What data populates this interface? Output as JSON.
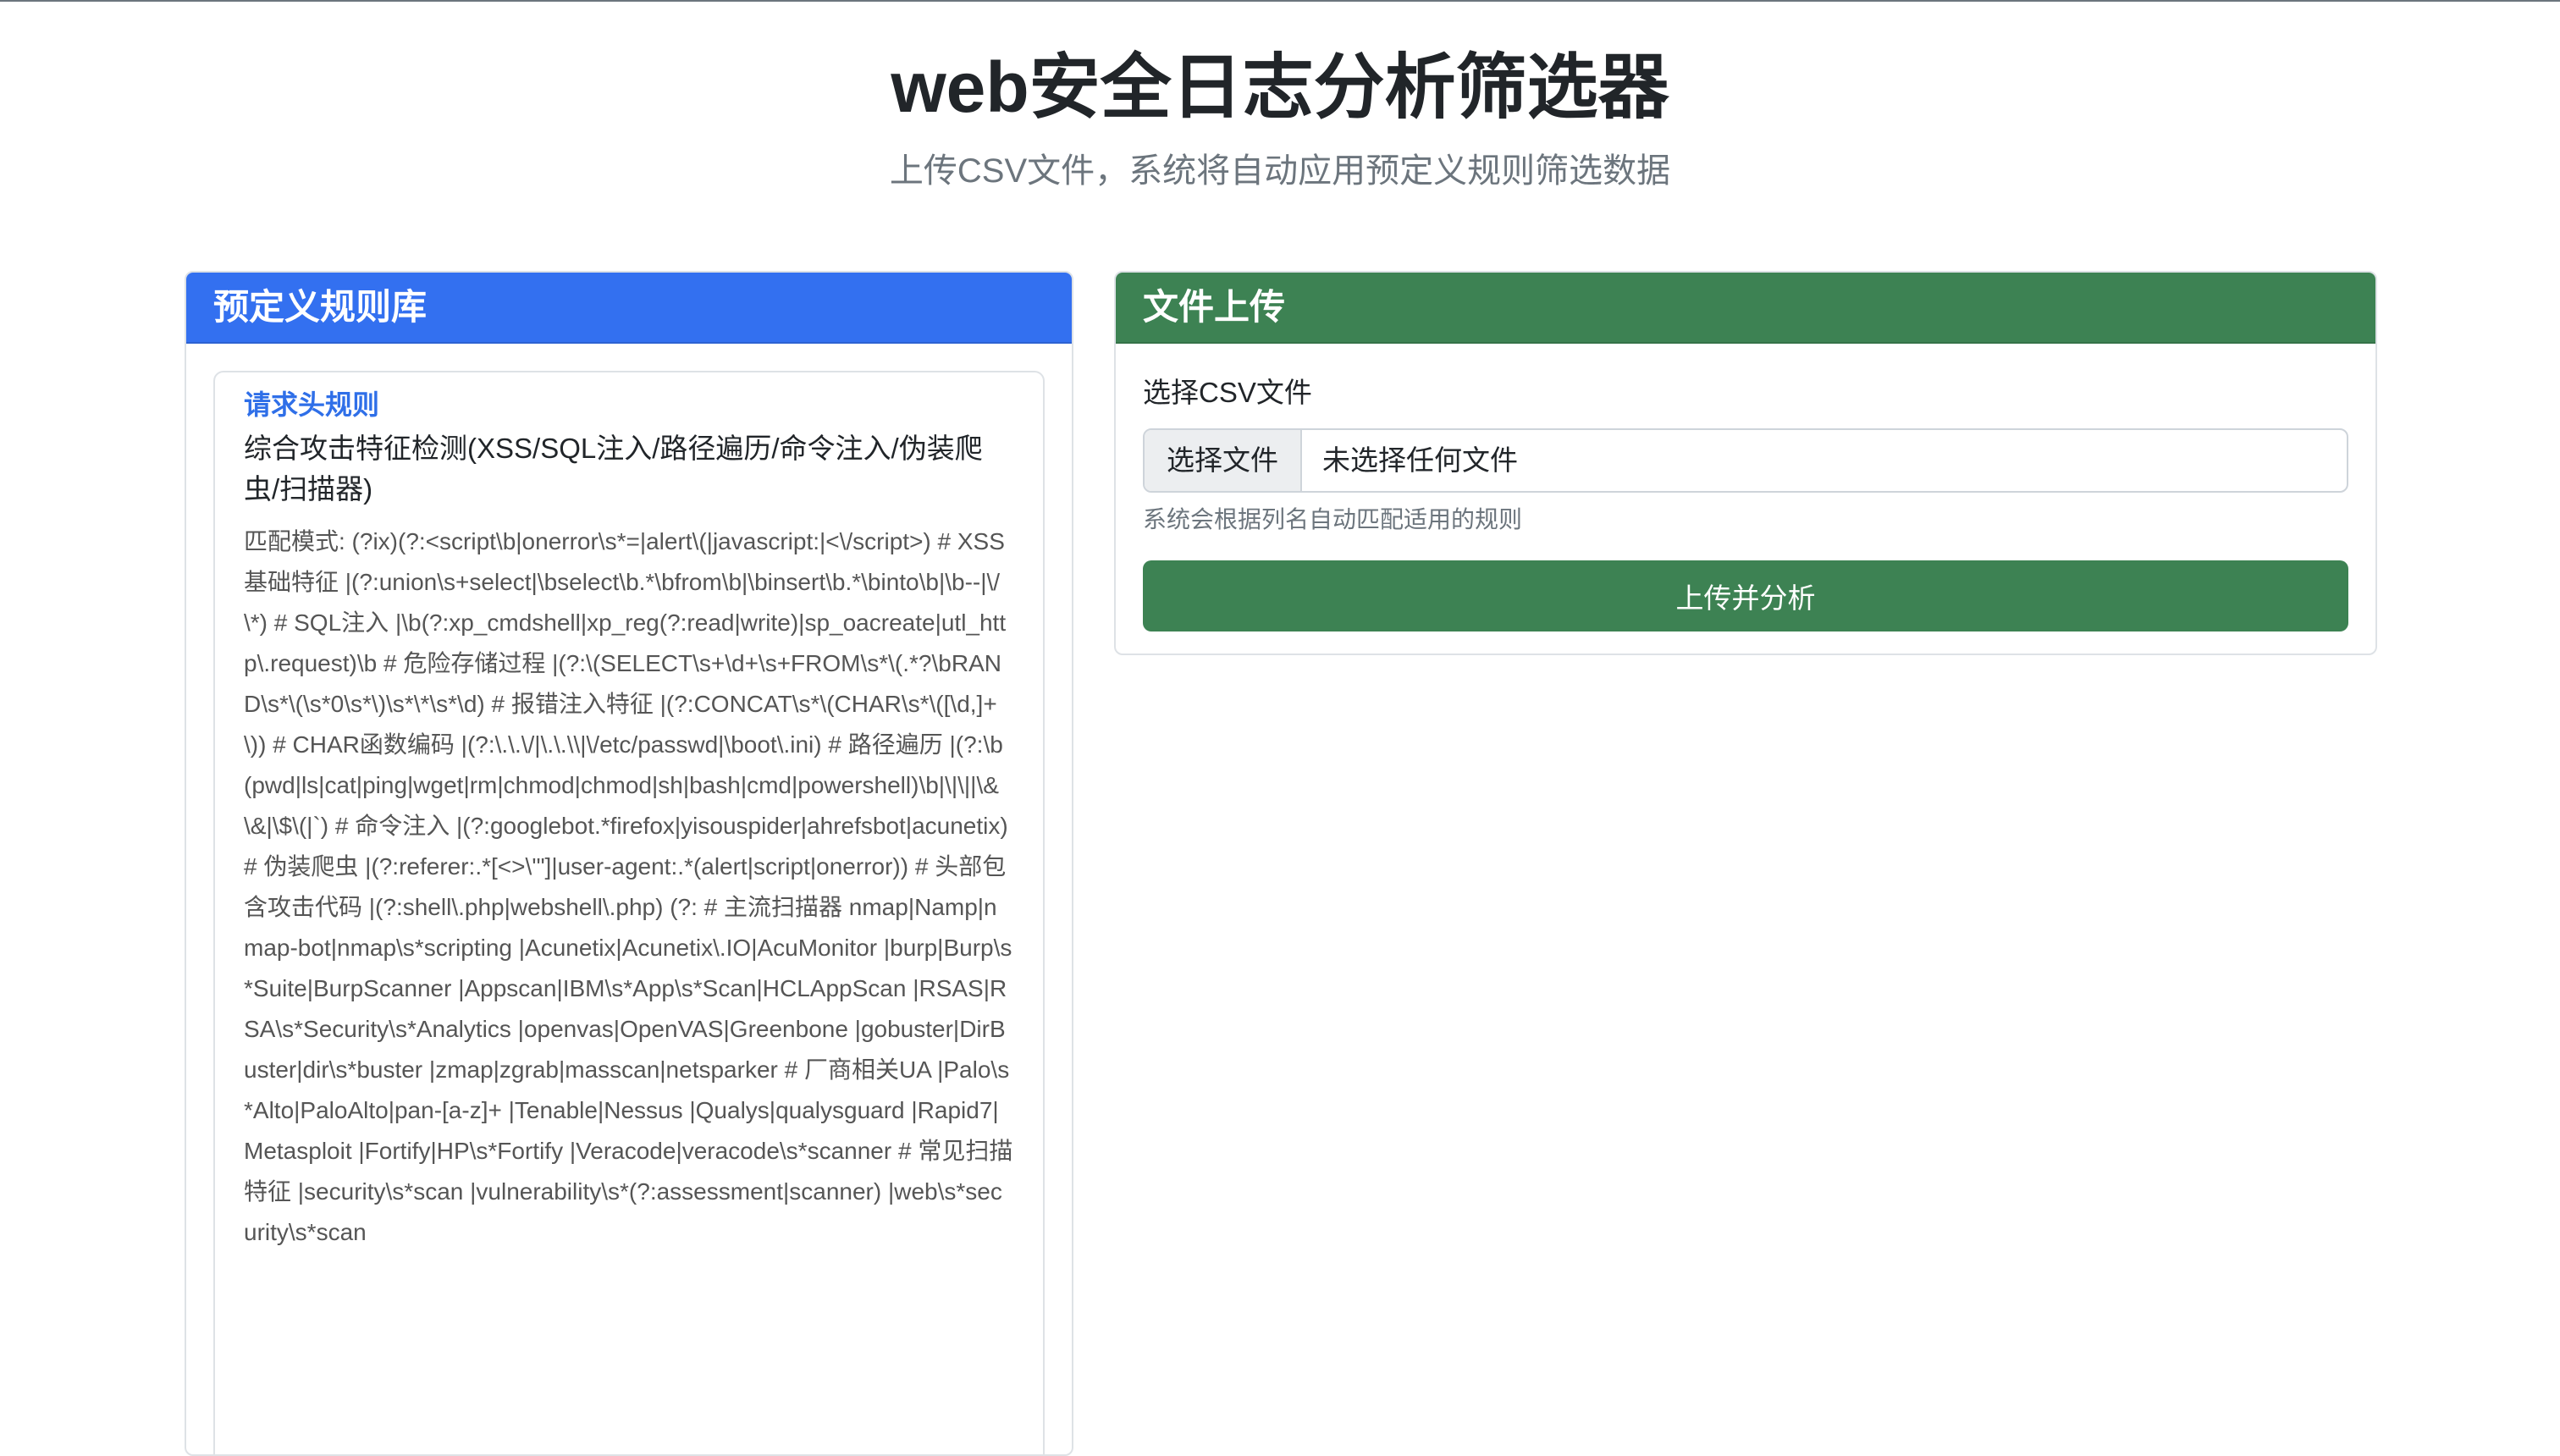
{
  "page": {
    "title": "web安全日志分析筛选器",
    "subtitle": "上传CSV文件，系统将自动应用预定义规则筛选数据"
  },
  "rules_panel": {
    "header": "预定义规则库",
    "rules": [
      {
        "category": "请求头规则",
        "name": "综合攻击特征检测(XSS/SQL注入/路径遍历/命令注入/伪装爬虫/扫描器)",
        "pattern": "匹配模式: (?ix)(?:<script\\b|onerror\\s*=|alert\\(|javascript:|<\\/script>) # XSS基础特征 |(?:union\\s+select|\\bselect\\b.*\\bfrom\\b|\\binsert\\b.*\\binto\\b|\\b--|\\/\\*) # SQL注入 |\\b(?:xp_cmdshell|xp_reg(?:read|write)|sp_oacreate|utl_http\\.request)\\b # 危险存储过程 |(?:\\(SELECT\\s+\\d+\\s+FROM\\s*\\(.*?\\bRAND\\s*\\(\\s*0\\s*\\)\\s*\\*\\s*\\d) # 报错注入特征 |(?:CONCAT\\s*\\(CHAR\\s*\\([\\d,]+\\)) # CHAR函数编码 |(?:\\.\\.\\/|\\.\\.\\\\|\\/etc/passwd|\\boot\\.ini) # 路径遍历 |(?:\\b(pwd|ls|cat|ping|wget|rm|chmod|chmod|sh|bash|cmd|powershell)\\b|\\|\\||\\&\\&|\\$\\(|`) # 命令注入 |(?:googlebot.*firefox|yisouspider|ahrefsbot|acunetix) # 伪装爬虫 |(?:referer:.*[<>\\'\"]|user-agent:.*(alert|script|onerror)) # 头部包含攻击代码 |(?:shell\\.php|webshell\\.php) (?: # 主流扫描器 nmap|Namp|nmap-bot|nmap\\s*scripting |Acunetix|Acunetix\\.IO|AcuMonitor |burp|Burp\\s*Suite|BurpScanner |Appscan|IBM\\s*App\\s*Scan|HCLAppScan |RSAS|RSA\\s*Security\\s*Analytics |openvas|OpenVAS|Greenbone |gobuster|DirBuster|dir\\s*buster |zmap|zgrab|masscan|netsparker # 厂商相关UA |Palo\\s*Alto|PaloAlto|pan-[a-z]+ |Tenable|Nessus |Qualys|qualysguard |Rapid7|Metasploit |Fortify|HP\\s*Fortify |Veracode|veracode\\s*scanner # 常见扫描特征 |security\\s*scan |vulnerability\\s*(?:assessment|scanner) |web\\s*security\\s*scan"
      }
    ]
  },
  "upload_panel": {
    "header": "文件上传",
    "field_label": "选择CSV文件",
    "file_button": "选择文件",
    "file_status": "未选择任何文件",
    "help_text": "系统会根据列名自动匹配适用的规则",
    "submit_label": "上传并分析"
  },
  "colors": {
    "rules_header": "#3370f0",
    "upload_header": "#3d8253",
    "category_text": "#2f6fe8"
  }
}
